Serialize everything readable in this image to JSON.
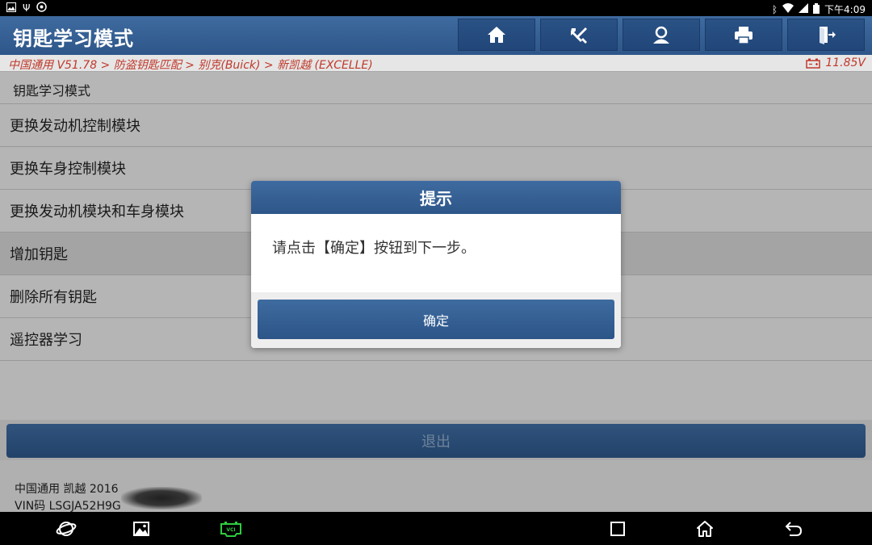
{
  "status_bar": {
    "time": "下午4:09",
    "left_icons": [
      "image-icon",
      "usb-debug-icon",
      "vpn-icon"
    ],
    "right_icons": [
      "bluetooth-icon",
      "wifi-icon",
      "signal-icon",
      "battery-icon"
    ]
  },
  "header": {
    "title": "钥匙学习模式",
    "toolbar": [
      {
        "name": "home-icon"
      },
      {
        "name": "diagnose-tools-icon"
      },
      {
        "name": "user-icon"
      },
      {
        "name": "print-icon"
      },
      {
        "name": "exit-door-icon"
      }
    ]
  },
  "breadcrumb": {
    "text": "中国通用 V51.78 > 防盗钥匙匹配 > 别克(Buick) > 新凯越 (EXCELLE)",
    "voltage": "11.85V",
    "voltage_icon": "battery-icon"
  },
  "section": {
    "header": "钥匙学习模式"
  },
  "menu": {
    "items": [
      {
        "label": "更换发动机控制模块"
      },
      {
        "label": "更换车身控制模块"
      },
      {
        "label": "更换发动机模块和车身模块"
      },
      {
        "label": "增加钥匙"
      },
      {
        "label": "删除所有钥匙"
      },
      {
        "label": "遥控器学习"
      }
    ]
  },
  "exit_button": {
    "label": "退出"
  },
  "footer": {
    "vehicle": "中国通用 凯越 2016",
    "vin": "VIN码 LSGJA52H9G"
  },
  "dialog": {
    "title": "提示",
    "message": "请点击【确定】按钮到下一步。",
    "ok_label": "确定"
  },
  "nav": {
    "icons": [
      "browser-icon",
      "gallery-icon",
      "vci-icon",
      "recent-apps-icon",
      "home-nav-icon",
      "back-icon"
    ]
  },
  "colors": {
    "header_blue": "#2e5689",
    "breadcrumb_red": "#c0392b",
    "vci_green": "#2ecc40"
  }
}
